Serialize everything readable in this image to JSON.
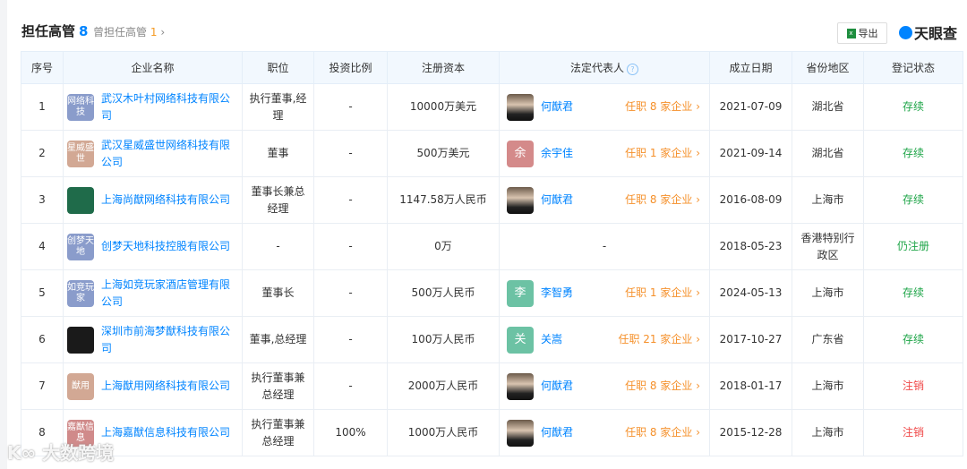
{
  "header": {
    "title": "担任高管",
    "count": "8",
    "past_label": "曾担任高管",
    "past_count": "1",
    "export_label": "导出",
    "brand": "天眼查"
  },
  "columns": [
    "序号",
    "企业名称",
    "职位",
    "投资比例",
    "注册资本",
    "法定代表人",
    "成立日期",
    "省份地区",
    "登记状态"
  ],
  "rows": [
    {
      "no": "1",
      "logo_text": "网络科技",
      "logo_color": "#8a9ccb",
      "company": "武汉木叶村网络科技有限公司",
      "position": "执行董事,经理",
      "ratio": "-",
      "capital": "10000万美元",
      "rep": "何猷君",
      "rep_avatar": "photo",
      "rep_jobs": "任职 8 家企业",
      "date": "2021-07-09",
      "region": "湖北省",
      "status": "存续",
      "status_type": "ok"
    },
    {
      "no": "2",
      "logo_text": "星威盛世",
      "logo_color": "#d2a894",
      "company": "武汉星威盛世网络科技有限公司",
      "position": "董事",
      "ratio": "-",
      "capital": "500万美元",
      "rep": "余宇佳",
      "rep_avatar": "余",
      "rep_avatar_color": "#d48a8a",
      "rep_jobs": "任职 1 家企业",
      "date": "2021-09-14",
      "region": "湖北省",
      "status": "存续",
      "status_type": "ok"
    },
    {
      "no": "3",
      "logo_text": "",
      "logo_color": "#1f6b4a",
      "company": "上海尚猷网络科技有限公司",
      "position": "董事长兼总经理",
      "ratio": "-",
      "capital": "1147.58万人民币",
      "rep": "何猷君",
      "rep_avatar": "photo",
      "rep_jobs": "任职 8 家企业",
      "date": "2016-08-09",
      "region": "上海市",
      "status": "存续",
      "status_type": "ok"
    },
    {
      "no": "4",
      "logo_text": "创梦天地",
      "logo_color": "#8a9ccb",
      "company": "创梦天地科技控股有限公司",
      "position": "-",
      "ratio": "-",
      "capital": "0万",
      "rep": "-",
      "rep_avatar": "",
      "rep_jobs": "",
      "date": "2018-05-23",
      "region": "香港特别行政区",
      "status": "仍注册",
      "status_type": "ok"
    },
    {
      "no": "5",
      "logo_text": "如竞玩家",
      "logo_color": "#8a9ccb",
      "company": "上海如竞玩家酒店管理有限公司",
      "position": "董事长",
      "ratio": "-",
      "capital": "500万人民币",
      "rep": "李智勇",
      "rep_avatar": "李",
      "rep_avatar_color": "#6cc2a4",
      "rep_jobs": "任职 1 家企业",
      "date": "2024-05-13",
      "region": "上海市",
      "status": "存续",
      "status_type": "ok"
    },
    {
      "no": "6",
      "logo_text": "",
      "logo_color": "#1a1a1a",
      "company": "深圳市前海梦猷科技有限公司",
      "position": "董事,总经理",
      "ratio": "-",
      "capital": "100万人民币",
      "rep": "关嵩",
      "rep_avatar": "关",
      "rep_avatar_color": "#6cc2a4",
      "rep_jobs": "任职 21 家企业",
      "date": "2017-10-27",
      "region": "广东省",
      "status": "存续",
      "status_type": "ok"
    },
    {
      "no": "7",
      "logo_text": "猷用",
      "logo_color": "#d2a894",
      "company": "上海猷用网络科技有限公司",
      "position": "执行董事兼总经理",
      "ratio": "-",
      "capital": "2000万人民币",
      "rep": "何猷君",
      "rep_avatar": "photo",
      "rep_jobs": "任职 8 家企业",
      "date": "2018-01-17",
      "region": "上海市",
      "status": "注销",
      "status_type": "bad"
    },
    {
      "no": "8",
      "logo_text": "嘉猷信息",
      "logo_color": "#d08a8a",
      "company": "上海嘉猷信息科技有限公司",
      "position": "执行董事兼总经理",
      "ratio": "100%",
      "capital": "1000万人民币",
      "rep": "何猷君",
      "rep_avatar": "photo",
      "rep_jobs": "任职 8 家企业",
      "date": "2015-12-28",
      "region": "上海市",
      "status": "注销",
      "status_type": "bad"
    }
  ],
  "watermark": "大数跨境"
}
